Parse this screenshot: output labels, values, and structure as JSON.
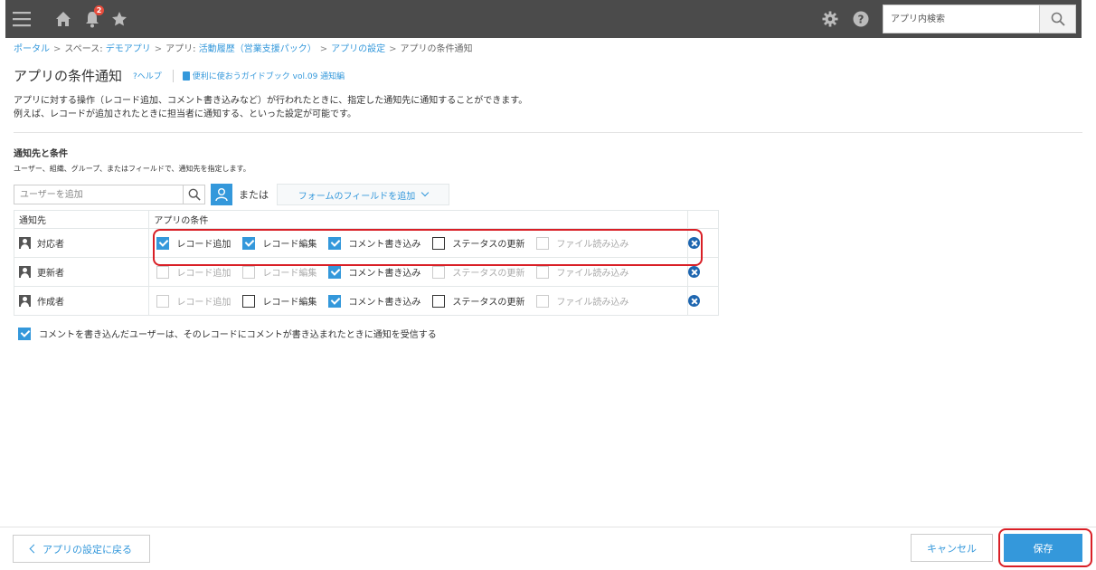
{
  "header": {
    "notification_count": "2",
    "search_placeholder": "アプリ内検索"
  },
  "breadcrumb": {
    "portal": "ポータル",
    "space_prefix": "スペース:",
    "space": "デモアプリ",
    "app_prefix": "アプリ:",
    "app": "活動履歴（営業支援パック）",
    "settings": "アプリの設定",
    "current": "アプリの条件通知",
    "separator": ">"
  },
  "page": {
    "title": "アプリの条件通知",
    "help": "?ヘルプ",
    "guide": "便利に使おうガイドブック vol.09 通知編",
    "desc_line1": "アプリに対する操作（レコード追加、コメント書き込みなど）が行われたときに、指定した通知先に通知することができます。",
    "desc_line2": "例えば、レコードが追加されたときに担当者に通知する、といった設定が可能です。"
  },
  "section": {
    "title": "通知先と条件",
    "desc": "ユーザー、組織、グループ、またはフィールドで、通知先を指定します。",
    "user_input_placeholder": "ユーザーを追加",
    "or": "または",
    "field_add": "フォームのフィールドを追加"
  },
  "table": {
    "headers": {
      "target": "通知先",
      "conditions": "アプリの条件"
    },
    "condition_labels": [
      "レコード追加",
      "レコード編集",
      "コメント書き込み",
      "ステータスの更新",
      "ファイル読み込み"
    ],
    "rows": [
      {
        "target": "対応者",
        "checks": [
          "checked",
          "checked",
          "checked",
          "unchecked",
          "disabled"
        ]
      },
      {
        "target": "更新者",
        "checks": [
          "disabled",
          "disabled",
          "checked",
          "disabled",
          "disabled"
        ]
      },
      {
        "target": "作成者",
        "checks": [
          "disabled",
          "unchecked",
          "checked",
          "unchecked",
          "disabled"
        ]
      }
    ]
  },
  "option": {
    "label": "コメントを書き込んだユーザーは、そのレコードにコメントが書き込まれたときに通知を受信する",
    "checked": true
  },
  "footer": {
    "back": "アプリの設定に戻る",
    "cancel": "キャンセル",
    "save": "保存"
  },
  "colors": {
    "accent": "#3498db",
    "highlight": "#d91f26",
    "header_bg": "#4b4b4b"
  }
}
